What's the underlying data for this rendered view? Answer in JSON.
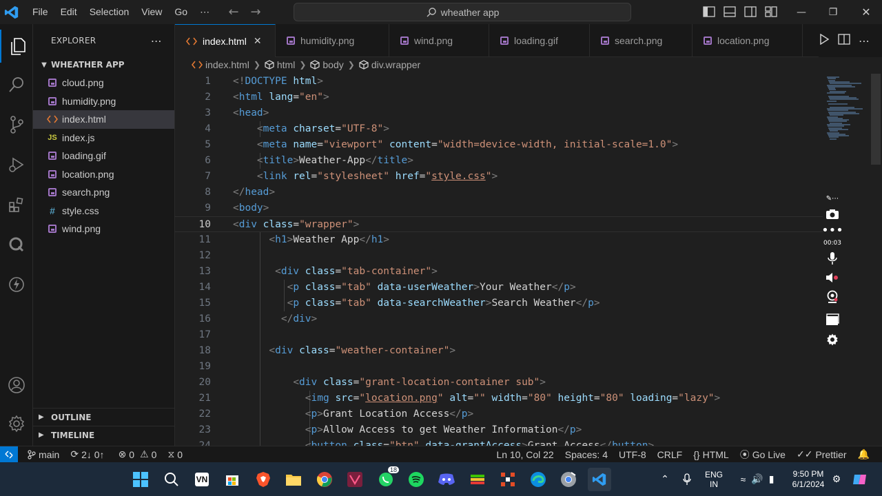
{
  "titlebar": {
    "menus": [
      "File",
      "Edit",
      "Selection",
      "View",
      "Go",
      "⋯"
    ],
    "search_text": "wheather app",
    "accent": "#0078d4"
  },
  "sidebar": {
    "title": "EXPLORER",
    "more": "⋯",
    "folder": "WHEATHER APP",
    "files": [
      {
        "name": "cloud.png",
        "icon": "image-icon"
      },
      {
        "name": "humidity.png",
        "icon": "image-icon"
      },
      {
        "name": "index.html",
        "icon": "html-icon",
        "selected": true
      },
      {
        "name": "index.js",
        "icon": "js-icon",
        "badge": "JS"
      },
      {
        "name": "loading.gif",
        "icon": "image-icon"
      },
      {
        "name": "location.png",
        "icon": "image-icon"
      },
      {
        "name": "search.png",
        "icon": "image-icon"
      },
      {
        "name": "style.css",
        "icon": "css-icon",
        "badge": "#"
      },
      {
        "name": "wind.png",
        "icon": "image-icon"
      }
    ],
    "outline": "OUTLINE",
    "timeline": "TIMELINE"
  },
  "tabs": [
    {
      "label": "index.html",
      "active": true,
      "close": "✕"
    },
    {
      "label": "humidity.png"
    },
    {
      "label": "wind.png"
    },
    {
      "label": "loading.gif"
    },
    {
      "label": "search.png"
    },
    {
      "label": "location.png"
    }
  ],
  "breadcrumb": [
    "index.html",
    "html",
    "body",
    "div.wrapper"
  ],
  "editor": {
    "current_line": 10,
    "lines": [
      {
        "n": "1",
        "html": "<span class='t-br'>&lt;!</span><span class='t-tag'>DOCTYPE</span> <span class='t-attr'>html</span><span class='t-br'>&gt;</span>"
      },
      {
        "n": "2",
        "html": "<span class='t-br'>&lt;</span><span class='t-tag'>html</span> <span class='t-attr'>lang</span><span class='t-txt'>=</span><span class='t-str'>\"en\"</span><span class='t-br'>&gt;</span>"
      },
      {
        "n": "3",
        "html": "<span class='t-br'>&lt;</span><span class='t-tag'>head</span><span class='t-br'>&gt;</span>"
      },
      {
        "n": "4",
        "html": "    <span class='t-br'>&lt;</span><span class='t-tag'>meta</span> <span class='t-attr'>charset</span><span class='t-txt'>=</span><span class='t-str'>\"UTF-8\"</span><span class='t-br'>&gt;</span>"
      },
      {
        "n": "5",
        "html": "    <span class='t-br'>&lt;</span><span class='t-tag'>meta</span> <span class='t-attr'>name</span><span class='t-txt'>=</span><span class='t-str'>\"viewport\"</span> <span class='t-attr'>content</span><span class='t-txt'>=</span><span class='t-str'>\"width=device-width, initial-scale=1.0\"</span><span class='t-br'>&gt;</span>"
      },
      {
        "n": "6",
        "html": "    <span class='t-br'>&lt;</span><span class='t-tag'>title</span><span class='t-br'>&gt;</span><span class='t-txt'>Weather-App</span><span class='t-br'>&lt;/</span><span class='t-tag'>title</span><span class='t-br'>&gt;</span>"
      },
      {
        "n": "7",
        "html": "    <span class='t-br'>&lt;</span><span class='t-tag'>link</span> <span class='t-attr'>rel</span><span class='t-txt'>=</span><span class='t-str'>\"stylesheet\"</span> <span class='t-attr'>href</span><span class='t-txt'>=</span><span class='t-str'>\"</span><span class='t-link'>style.css</span><span class='t-str'>\"</span><span class='t-br'>&gt;</span>"
      },
      {
        "n": "8",
        "html": "<span class='t-br'>&lt;/</span><span class='t-tag'>head</span><span class='t-br'>&gt;</span>"
      },
      {
        "n": "9",
        "html": "<span class='t-br'>&lt;</span><span class='t-tag'>body</span><span class='t-br'>&gt;</span>"
      },
      {
        "n": "10",
        "html": "<span class='t-br'>&lt;</span><span class='t-tag'>div</span> <span class='t-attr'>class</span><span class='t-txt'>=</span><span class='t-str'>\"wrapper\"</span><span class='t-br'>&gt;</span>"
      },
      {
        "n": "11",
        "html": "      <span class='t-br'>&lt;</span><span class='t-tag'>h1</span><span class='t-br'>&gt;</span><span class='t-txt'>Weather App</span><span class='t-br'>&lt;/</span><span class='t-tag'>h1</span><span class='t-br'>&gt;</span>"
      },
      {
        "n": "12",
        "html": ""
      },
      {
        "n": "13",
        "html": "       <span class='t-br'>&lt;</span><span class='t-tag'>div</span> <span class='t-attr'>class</span><span class='t-txt'>=</span><span class='t-str'>\"tab-container\"</span><span class='t-br'>&gt;</span>"
      },
      {
        "n": "14",
        "html": "         <span class='t-br'>&lt;</span><span class='t-tag'>p</span> <span class='t-attr'>class</span><span class='t-txt'>=</span><span class='t-str'>\"tab\"</span> <span class='t-attr'>data-userWeather</span><span class='t-br'>&gt;</span><span class='t-txt'>Your Weather</span><span class='t-br'>&lt;/</span><span class='t-tag'>p</span><span class='t-br'>&gt;</span>"
      },
      {
        "n": "15",
        "html": "         <span class='t-br'>&lt;</span><span class='t-tag'>p</span> <span class='t-attr'>class</span><span class='t-txt'>=</span><span class='t-str'>\"tab\"</span> <span class='t-attr'>data-searchWeather</span><span class='t-br'>&gt;</span><span class='t-txt'>Search Weather</span><span class='t-br'>&lt;/</span><span class='t-tag'>p</span><span class='t-br'>&gt;</span>"
      },
      {
        "n": "16",
        "html": "        <span class='t-br'>&lt;/</span><span class='t-tag'>div</span><span class='t-br'>&gt;</span>"
      },
      {
        "n": "17",
        "html": ""
      },
      {
        "n": "18",
        "html": "      <span class='t-br'>&lt;</span><span class='t-tag'>div</span> <span class='t-attr'>class</span><span class='t-txt'>=</span><span class='t-str'>\"weather-container\"</span><span class='t-br'>&gt;</span>"
      },
      {
        "n": "19",
        "html": ""
      },
      {
        "n": "20",
        "html": "          <span class='t-br'>&lt;</span><span class='t-tag'>div</span> <span class='t-attr'>class</span><span class='t-txt'>=</span><span class='t-str'>\"grant-location-container sub\"</span><span class='t-br'>&gt;</span>"
      },
      {
        "n": "21",
        "html": "            <span class='t-br'>&lt;</span><span class='t-tag'>img</span> <span class='t-attr'>src</span><span class='t-txt'>=</span><span class='t-str'>\"</span><span class='t-link'>location.png</span><span class='t-str'>\"</span> <span class='t-attr'>alt</span><span class='t-txt'>=</span><span class='t-str'>\"\"</span> <span class='t-attr'>width</span><span class='t-txt'>=</span><span class='t-str'>\"80\"</span> <span class='t-attr'>height</span><span class='t-txt'>=</span><span class='t-str'>\"80\"</span> <span class='t-attr'>loading</span><span class='t-txt'>=</span><span class='t-str'>\"lazy\"</span><span class='t-br'>&gt;</span>"
      },
      {
        "n": "22",
        "html": "            <span class='t-br'>&lt;</span><span class='t-tag'>p</span><span class='t-br'>&gt;</span><span class='t-txt'>Grant Location Access</span><span class='t-br'>&lt;/</span><span class='t-tag'>p</span><span class='t-br'>&gt;</span>"
      },
      {
        "n": "23",
        "html": "            <span class='t-br'>&lt;</span><span class='t-tag'>p</span><span class='t-br'>&gt;</span><span class='t-txt'>Allow Access to get Weather Information</span><span class='t-br'>&lt;/</span><span class='t-tag'>p</span><span class='t-br'>&gt;</span>"
      },
      {
        "n": "24",
        "html": "            <span class='t-br'>&lt;</span><span class='t-tag'>button</span> <span class='t-attr'>class</span><span class='t-txt'>=</span><span class='t-str'>\"btn\"</span> <span class='t-attr'>data-grantAccess</span><span class='t-br'>&gt;</span><span class='t-txt'>Grant Access</span><span class='t-br'>&lt;/</span><span class='t-tag'>button</span><span class='t-br'>&gt;</span>"
      }
    ]
  },
  "recorder": {
    "time": "00:03"
  },
  "statusbar": {
    "branch": "main",
    "sync": "2↓ 0↑",
    "errors": "0",
    "warnings": "0",
    "ports": "0",
    "position": "Ln 10, Col 22",
    "spaces": "Spaces: 4",
    "encoding": "UTF-8",
    "eol": "CRLF",
    "language": "HTML",
    "golive": "Go Live",
    "prettier": "Prettier"
  },
  "taskbar": {
    "lang1": "ENG",
    "lang2": "IN",
    "time": "9:50 PM",
    "date": "6/1/2024",
    "whatsapp_badge": "18",
    "vn_label": "VN"
  }
}
